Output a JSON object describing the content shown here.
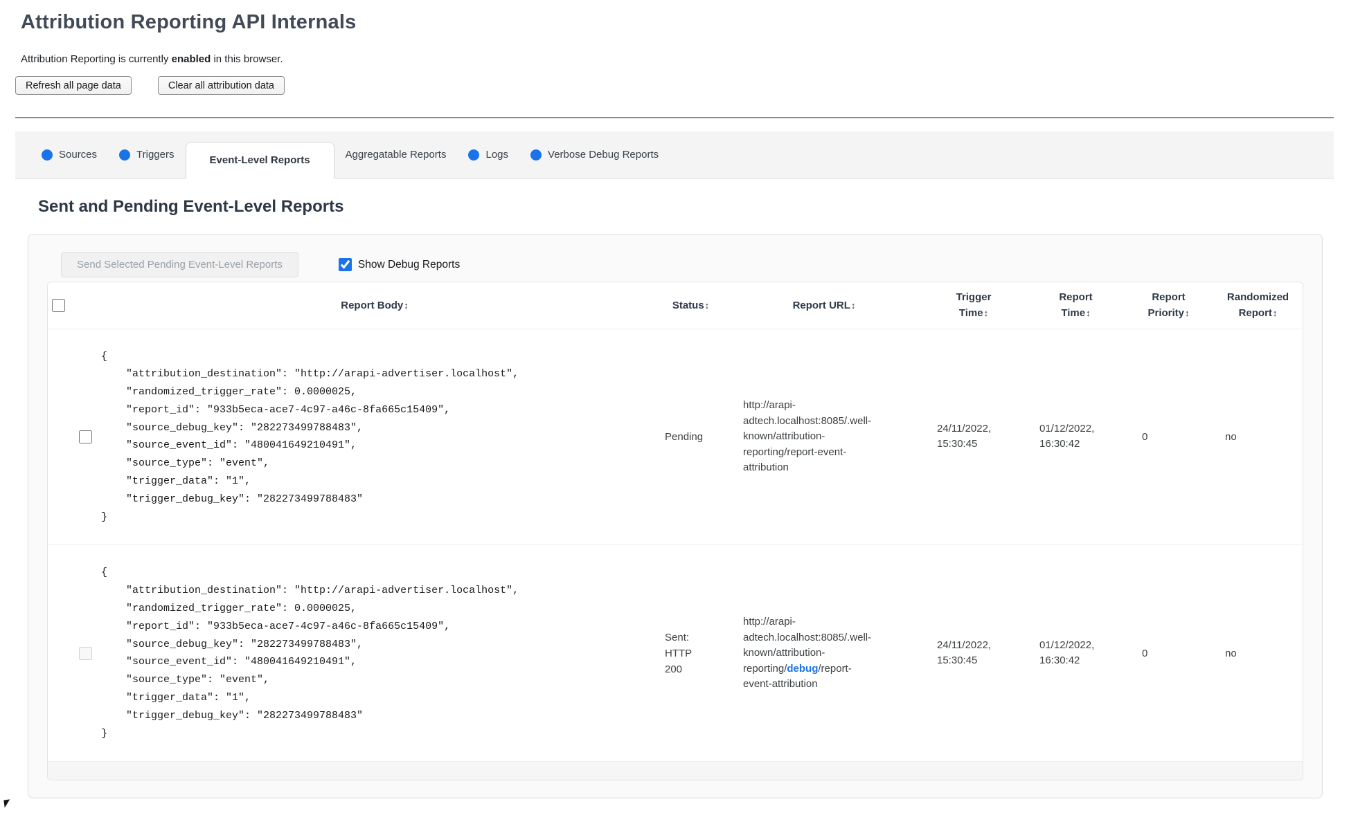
{
  "page": {
    "title": "Attribution Reporting API Internals",
    "status_prefix": "Attribution Reporting is currently ",
    "status_bold": "enabled",
    "status_suffix": " in this browser.",
    "refresh_button": "Refresh all page data",
    "clear_button": "Clear all attribution data"
  },
  "tabs": [
    {
      "label": "Sources",
      "has_dot": true,
      "active": false
    },
    {
      "label": "Triggers",
      "has_dot": true,
      "active": false
    },
    {
      "label": "Event-Level Reports",
      "has_dot": false,
      "active": true
    },
    {
      "label": "Aggregatable Reports",
      "has_dot": false,
      "active": false
    },
    {
      "label": "Logs",
      "has_dot": true,
      "active": false
    },
    {
      "label": "Verbose Debug Reports",
      "has_dot": true,
      "active": false
    }
  ],
  "section": {
    "heading": "Sent and Pending Event-Level Reports",
    "send_button": "Send Selected Pending Event-Level Reports",
    "send_button_disabled": true,
    "show_debug_label": "Show Debug Reports",
    "show_debug_checked": true
  },
  "table": {
    "sort_icon": "↕",
    "columns": [
      "Report Body",
      "Status",
      "Report URL",
      "Trigger Time",
      "Report Time",
      "Report Priority",
      "Randomized Report"
    ],
    "rows": [
      {
        "report_body": "{\n    \"attribution_destination\": \"http://arapi-advertiser.localhost\",\n    \"randomized_trigger_rate\": 0.0000025,\n    \"report_id\": \"933b5eca-ace7-4c97-a46c-8fa665c15409\",\n    \"source_debug_key\": \"282273499788483\",\n    \"source_event_id\": \"480041649210491\",\n    \"source_type\": \"event\",\n    \"trigger_data\": \"1\",\n    \"trigger_debug_key\": \"282273499788483\"\n}",
        "status": "Pending",
        "url_pre": "http://arapi-adtech.localhost:8085/.well-known/attribution-reporting/report-event-attribution",
        "url_debug": "",
        "url_post": "",
        "trigger_time": "24/11/2022, 15:30:45",
        "report_time": "01/12/2022, 16:30:42",
        "report_priority": "0",
        "randomized_report": "no",
        "checkbox_disabled": false
      },
      {
        "report_body": "{\n    \"attribution_destination\": \"http://arapi-advertiser.localhost\",\n    \"randomized_trigger_rate\": 0.0000025,\n    \"report_id\": \"933b5eca-ace7-4c97-a46c-8fa665c15409\",\n    \"source_debug_key\": \"282273499788483\",\n    \"source_event_id\": \"480041649210491\",\n    \"source_type\": \"event\",\n    \"trigger_data\": \"1\",\n    \"trigger_debug_key\": \"282273499788483\"\n}",
        "status": "Sent: HTTP 200",
        "url_pre": "http://arapi-adtech.localhost:8085/.well-known/attribution-reporting/",
        "url_debug": "debug",
        "url_post": "/report-event-attribution",
        "trigger_time": "24/11/2022, 15:30:45",
        "report_time": "01/12/2022, 16:30:42",
        "report_priority": "0",
        "randomized_report": "no",
        "checkbox_disabled": true
      }
    ]
  },
  "colors": {
    "accent_blue": "#1a73e8",
    "heading_text": "#2e3744",
    "panel_bg": "#fafafa",
    "tabstrip_bg": "#f4f4f4"
  }
}
